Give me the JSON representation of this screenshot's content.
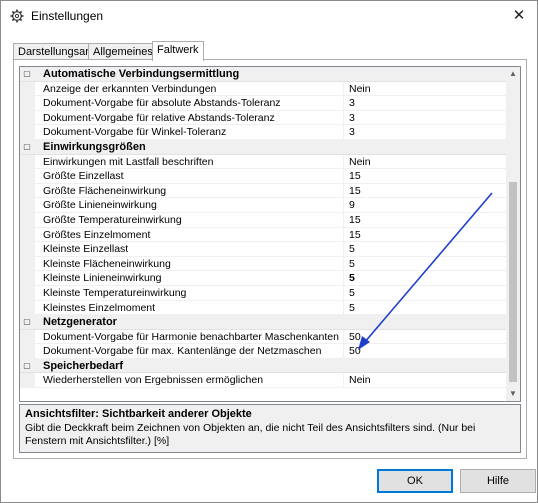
{
  "window": {
    "title": "Einstellungen",
    "close_symbol": "✕"
  },
  "tabs": [
    {
      "label": "Darstellungsart",
      "active": false
    },
    {
      "label": "Allgemeines",
      "active": false
    },
    {
      "label": "Faltwerk",
      "active": true
    }
  ],
  "property_grid": {
    "groups": [
      {
        "label": "Automatische Verbindungsermittlung",
        "expanded": true,
        "rows": [
          {
            "label": "Anzeige der erkannten Verbindungen",
            "value": "Nein"
          },
          {
            "label": "Dokument-Vorgabe für absolute Abstands-Toleranz",
            "value": "3"
          },
          {
            "label": "Dokument-Vorgabe für relative Abstands-Toleranz",
            "value": "3"
          },
          {
            "label": "Dokument-Vorgabe für Winkel-Toleranz",
            "value": "3"
          }
        ]
      },
      {
        "label": "Einwirkungsgrößen",
        "expanded": true,
        "rows": [
          {
            "label": "Einwirkungen mit Lastfall beschriften",
            "value": "Nein"
          },
          {
            "label": "Größte Einzellast",
            "value": "15"
          },
          {
            "label": "Größte Flächeneinwirkung",
            "value": "15"
          },
          {
            "label": "Größte Linieneinwirkung",
            "value": "9"
          },
          {
            "label": "Größte Temperatureinwirkung",
            "value": "15"
          },
          {
            "label": "Größtes Einzelmoment",
            "value": "15"
          },
          {
            "label": "Kleinste Einzellast",
            "value": "5"
          },
          {
            "label": "Kleinste Flächeneinwirkung",
            "value": "5"
          },
          {
            "label": "Kleinste Linieneinwirkung",
            "value": "5",
            "bold": true
          },
          {
            "label": "Kleinste Temperatureinwirkung",
            "value": "5"
          },
          {
            "label": "Kleinstes Einzelmoment",
            "value": "5"
          }
        ]
      },
      {
        "label": "Netzgenerator",
        "expanded": true,
        "rows": [
          {
            "label": "Dokument-Vorgabe für Harmonie benachbarter Maschenkanten",
            "value": "50"
          },
          {
            "label": "Dokument-Vorgabe für max. Kantenlänge der Netzmaschen",
            "value": "50"
          }
        ]
      },
      {
        "label": "Speicherbedarf",
        "expanded": true,
        "rows": [
          {
            "label": "Wiederherstellen von Ergebnissen ermöglichen",
            "value": "Nein"
          }
        ]
      }
    ],
    "toggle_symbol": "▢"
  },
  "description": {
    "title": "Ansichtsfilter: Sichtbarkeit anderer Objekte",
    "text": "Gibt die Deckkraft beim Zeichnen von Objekten an, die nicht Teil des Ansichtsfilters sind. (Nur bei Fenstern mit Ansichtsfilter.) [%]"
  },
  "buttons": {
    "ok": "OK",
    "help": "Hilfe"
  },
  "colors": {
    "annotation_arrow": "#1f3fc8",
    "category_bg": "#f0f0f0",
    "ok_border": "#0078d7"
  },
  "icons": {
    "title": "gear-icon",
    "close": "close-icon",
    "scroll_up": "chevron-up-icon",
    "scroll_down": "chevron-down-icon",
    "group_toggle": "collapse-icon"
  }
}
